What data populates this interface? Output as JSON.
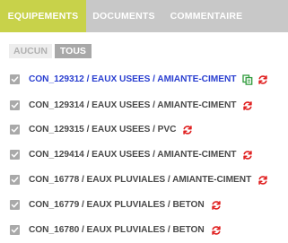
{
  "tabs": [
    {
      "label": "EQUIPEMENTS",
      "active": true
    },
    {
      "label": "DOCUMENTS",
      "active": false
    },
    {
      "label": "COMMENTAIRE",
      "active": false
    }
  ],
  "filter": {
    "aucun": "AUCUN",
    "tous": "TOUS",
    "selected": "TOUS"
  },
  "items": [
    {
      "label": "CON_129312 / EAUX USEES / AMIANTE-CIMENT",
      "checked": true,
      "highlighted": true,
      "icons": [
        "copy-icon",
        "refresh-icon"
      ]
    },
    {
      "label": "CON_129314 / EAUX USEES / AMIANTE-CIMENT",
      "checked": true,
      "highlighted": false,
      "icons": [
        "refresh-icon"
      ]
    },
    {
      "label": "CON_129315 / EAUX USEES / PVC",
      "checked": true,
      "highlighted": false,
      "icons": [
        "refresh-icon"
      ]
    },
    {
      "label": "CON_129414 / EAUX USEES / AMIANTE-CIMENT",
      "checked": true,
      "highlighted": false,
      "icons": [
        "refresh-icon"
      ]
    },
    {
      "label": "CON_16778 / EAUX PLUVIALES / AMIANTE-CIMENT",
      "checked": true,
      "highlighted": false,
      "icons": [
        "refresh-icon"
      ]
    },
    {
      "label": "CON_16779 / EAUX PLUVIALES / BETON",
      "checked": true,
      "highlighted": false,
      "icons": [
        "refresh-icon"
      ]
    },
    {
      "label": "CON_16780 / EAUX PLUVIALES / BETON",
      "checked": true,
      "highlighted": false,
      "icons": [
        "refresh-icon"
      ]
    }
  ],
  "colors": {
    "active_tab": "#c8d24a",
    "tab_bar": "#c8c8c8",
    "highlight_text": "#2a3fd0",
    "refresh_icon": "#e02020",
    "copy_icon": "#2e9a3a"
  }
}
